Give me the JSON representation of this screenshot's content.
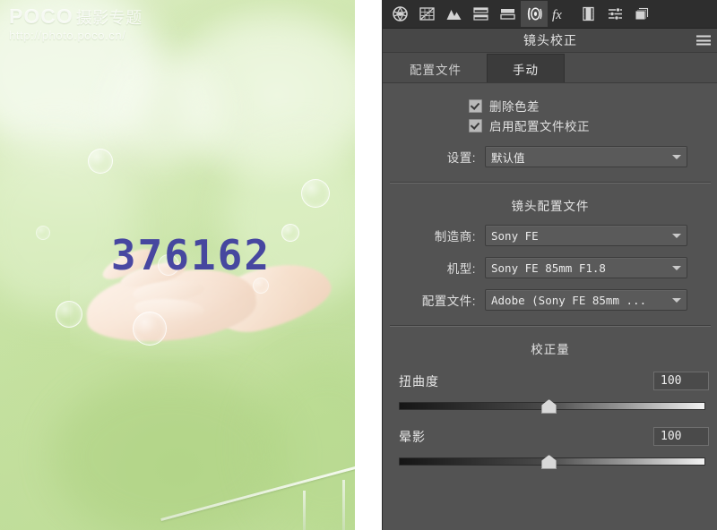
{
  "photo": {
    "watermark_brand": "POCO",
    "watermark_title": "摄影专题",
    "watermark_url": "http://photo.poco.cn/",
    "overlay_number": "376162",
    "overlay_number_color": "#3b3a9e",
    "alt": "soft green background with a hand and soap bubbles"
  },
  "panel": {
    "title": "镜头校正",
    "menu_icon": "hamburger-menu-icon",
    "toolbar": {
      "tools": [
        {
          "name": "basic-adjustments-icon",
          "label": "基本",
          "active": false
        },
        {
          "name": "tone-curve-icon",
          "label": "色调曲线",
          "active": false
        },
        {
          "name": "detail-icon",
          "label": "细节",
          "active": false
        },
        {
          "name": "hsl-grayscale-icon",
          "label": "HSL/灰度",
          "active": false
        },
        {
          "name": "split-toning-icon",
          "label": "分离色调",
          "active": false
        },
        {
          "name": "lens-correction-icon",
          "label": "镜头校正",
          "active": true
        },
        {
          "name": "effects-fx-icon",
          "label": "效果",
          "active": false
        },
        {
          "name": "camera-calibration-icon",
          "label": "相机校准",
          "active": false
        },
        {
          "name": "presets-icon",
          "label": "预设",
          "active": false
        },
        {
          "name": "snapshots-icon",
          "label": "快照",
          "active": false
        }
      ]
    },
    "tabs": [
      {
        "label": "配置文件",
        "active": false
      },
      {
        "label": "手动",
        "active": true
      }
    ],
    "checkboxes": [
      {
        "label": "删除色差",
        "checked": true
      },
      {
        "label": "启用配置文件校正",
        "checked": true
      }
    ],
    "settings_row": {
      "label": "设置:",
      "value": "默认值"
    },
    "lens_profile": {
      "heading": "镜头配置文件",
      "fields": [
        {
          "label": "制造商:",
          "value": "Sony FE"
        },
        {
          "label": "机型:",
          "value": "Sony FE 85mm F1.8"
        },
        {
          "label": "配置文件:",
          "value": "Adobe (Sony FE 85mm ..."
        }
      ]
    },
    "correction_amount": {
      "heading": "校正量",
      "sliders": [
        {
          "label": "扭曲度",
          "value": "100",
          "thumb_percent": 48
        },
        {
          "label": "晕影",
          "value": "100",
          "thumb_percent": 48
        }
      ]
    }
  }
}
